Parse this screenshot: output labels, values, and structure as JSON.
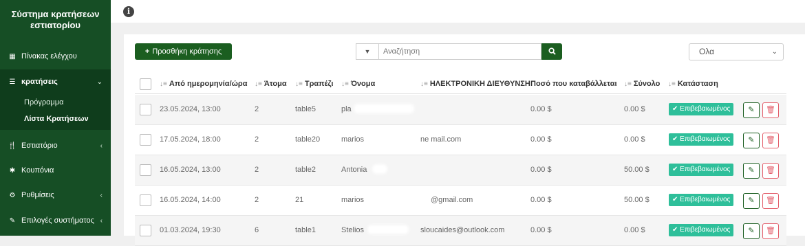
{
  "sidebar": {
    "brand": "Σύστημα κρατήσεων εστιατορίου",
    "items": [
      {
        "label": "Πίνακας ελέγχου",
        "icon": "dashboard-icon"
      },
      {
        "label": "κρατήσεις",
        "icon": "list-icon"
      },
      {
        "label": "Εστιατόριο",
        "icon": "utensils-icon"
      },
      {
        "label": "Κουπόνια",
        "icon": "gift-icon"
      },
      {
        "label": "Ρυθμίσεις",
        "icon": "gears-icon"
      },
      {
        "label": "Επιλογές συστήματος",
        "icon": "wrench-icon"
      }
    ],
    "sub_items": [
      {
        "label": "Πρόγραμμα"
      },
      {
        "label": "Λίστα Κρατήσεων",
        "active": true
      }
    ]
  },
  "toolbar": {
    "add_label": "Προσθήκη κράτησης",
    "search_placeholder": "Αναζήτηση",
    "filter_value": "Ολα"
  },
  "table": {
    "columns": [
      "Από ημερομηνία/ώρα",
      "Άτομα",
      "Τραπέζι",
      "Όνομα",
      "ΗΛΕΚΤΡΟΝΙΚΗ ΔΙΕΥΘΥΝΣΗ",
      "Ποσό που καταβάλλεται",
      "Σύνολο",
      "Κατάσταση"
    ],
    "rows": [
      {
        "date": "23.05.2024, 13:00",
        "people": "2",
        "table": "table5",
        "name": "pla",
        "email": "",
        "paid": "0.00 $",
        "total": "0.00 $",
        "status": "Επιβεβαιωμένος"
      },
      {
        "date": "17.05.2024, 18:00",
        "people": "2",
        "table": "table20",
        "name": "marios",
        "email": "ne mail.com",
        "paid": "0.00 $",
        "total": "0.00 $",
        "status": "Επιβεβαιωμένος"
      },
      {
        "date": "16.05.2024, 13:00",
        "people": "2",
        "table": "table2",
        "name": "Antonia",
        "email": "",
        "paid": "0.00 $",
        "total": "50.00 $",
        "status": "Επιβεβαιωμένος"
      },
      {
        "date": "16.05.2024, 14:00",
        "people": "2",
        "table": "21",
        "name": "marios",
        "email": "@gmail.com",
        "paid": "0.00 $",
        "total": "50.00 $",
        "status": "Επιβεβαιωμένος"
      },
      {
        "date": "01.03.2024, 19:30",
        "people": "6",
        "table": "table1",
        "name": "Stelios",
        "email": "sloucaides@outlook.com",
        "paid": "0.00 $",
        "total": "0.00 $",
        "status": "Επιβεβαιωμένος"
      }
    ]
  },
  "colors": {
    "sidebar": "#164e25",
    "primary": "#1b5e20",
    "badge": "#2ebf9a",
    "danger": "#e35d6a"
  }
}
